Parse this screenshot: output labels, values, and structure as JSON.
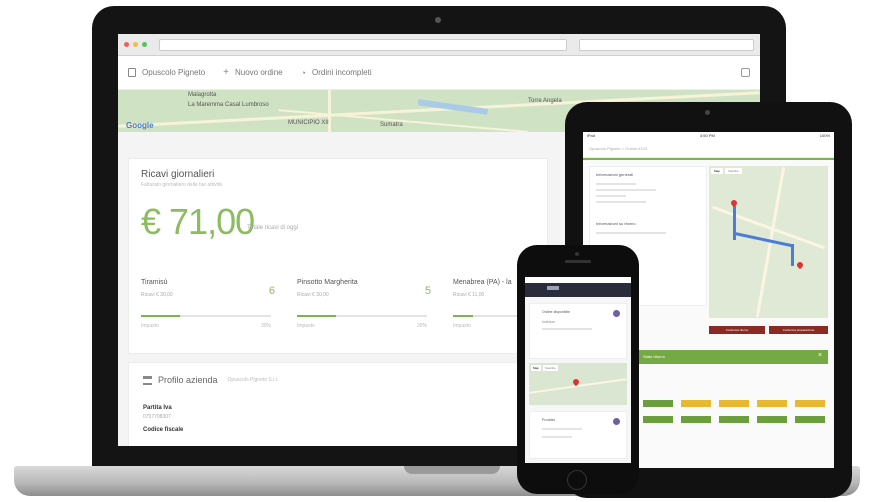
{
  "desktop": {
    "nav": {
      "item1": "Opuscolo Pigneto",
      "item2": "Nuovo ordine",
      "item3": "Ordini incompleti"
    },
    "map": {
      "labels": [
        "Malagrotta",
        "La Maremma Casal Lumbroso",
        "MUNICIPIO XII",
        "Sumatra",
        "Torre Angela"
      ],
      "logo": "Google"
    },
    "income": {
      "title": "Ricavi giornalieri",
      "subtitle": "Fatturato giornaliero delle tue attività",
      "amount": "€ 71,00",
      "amount_note": "Totale ricavi di oggi",
      "products": [
        {
          "name": "Tiramisù",
          "price": "Ricavi € 30,00",
          "count": "6",
          "foot_left": "Impasto",
          "foot_right": "30%",
          "fill": 0.3
        },
        {
          "name": "Pinsotto Margherita",
          "price": "Ricavi € 30,00",
          "count": "5",
          "foot_left": "Impasto",
          "foot_right": "30%",
          "fill": 0.3
        },
        {
          "name": "Menabrea (PA) - la",
          "price": "Ricavi € 11,00",
          "count": "",
          "foot_left": "Impasto",
          "foot_right": "",
          "fill": 0.15
        }
      ]
    },
    "company": {
      "title": "Profilo azienda",
      "subtitle": "Opuscolo Pigneto S.r.l.",
      "vat_label": "Partita Iva",
      "vat_value": "0797708307",
      "tax_label": "Codice fiscale"
    }
  },
  "tablet": {
    "status_left": "iPad",
    "status_center": "4:50 PM",
    "status_right": "100%",
    "breadcrumb": "Opuscolo Pigneto  >  Ordine #123",
    "section1": "Informazioni generali",
    "section2": "Informazioni su ritorno",
    "map_tab1": "Map",
    "map_tab2": "Satellite",
    "btn1": "Conferma ritorno",
    "btn2": "Conferma preparazione",
    "banner": "Stato ritorno",
    "colors": {
      "accent": "#7fb14f",
      "danger": "#8b2a24",
      "yellow": "#e8b930",
      "green": "#6b9e3c"
    }
  },
  "phone": {
    "card1_title": "Ordine disponibile",
    "card1_line": "Indirizzo",
    "map_tab1": "Map",
    "map_tab2": "Satellite",
    "card2_title": "Prodotto",
    "colors": {
      "nav": "#2a2c3b",
      "badge": "#6e5ea6"
    }
  }
}
